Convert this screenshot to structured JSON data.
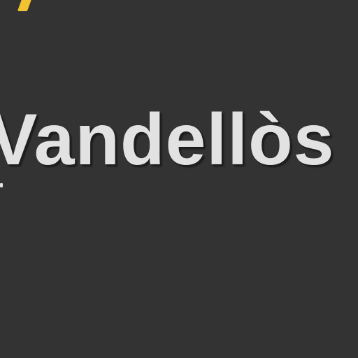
{
  "map": {
    "background_color": "#333333",
    "label_color": "#e2e2e2",
    "road_color": "#f2c230",
    "place_label": "Vandellòs"
  }
}
